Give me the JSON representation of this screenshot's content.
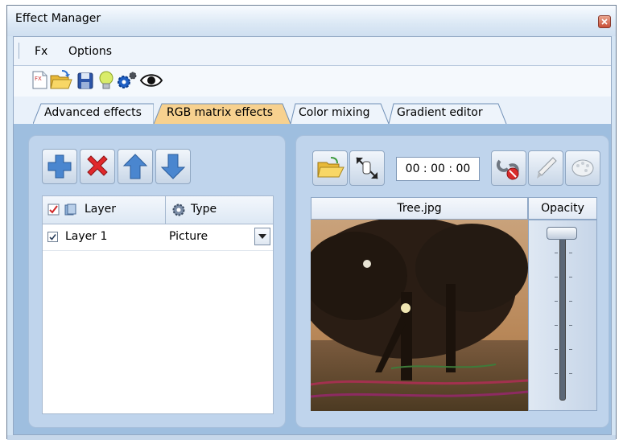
{
  "window": {
    "title": "Effect Manager",
    "close_icon": "close-icon"
  },
  "menu": {
    "items": [
      "Fx",
      "Options"
    ]
  },
  "toolbar": {
    "buttons": [
      "new-effect-icon",
      "open-folder-icon",
      "save-disk-icon",
      "light-bulb-icon",
      "gears-icon",
      "eye-icon"
    ]
  },
  "tabs": {
    "items": [
      "Advanced effects",
      "RGB matrix effects",
      "Color mixing",
      "Gradient editor"
    ],
    "active_index": 1
  },
  "layers": {
    "buttons": [
      "add-icon",
      "delete-icon",
      "move-up-icon",
      "move-down-icon"
    ],
    "columns": [
      "Layer",
      "Type"
    ],
    "rows": [
      {
        "name": "Layer 1",
        "checked": true,
        "type": "Picture"
      }
    ]
  },
  "preview": {
    "buttons": [
      "open-folder-icon",
      "resize-icon",
      "time-display",
      "unlink-icon",
      "brush-icon",
      "palette-icon"
    ],
    "time": "00 : 00 : 00",
    "image_title": "Tree.jpg",
    "opacity_label": "Opacity",
    "opacity_value": 1.0
  },
  "colors": {
    "accent_tab": "#f7d18f",
    "panel_bg": "#bfd4ec",
    "content_bg": "#9ebedf"
  }
}
